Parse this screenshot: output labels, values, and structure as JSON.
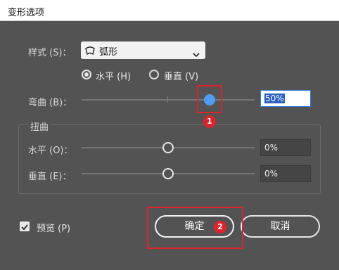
{
  "window": {
    "title": "变形选项"
  },
  "style_row": {
    "label": "样式 (S)：",
    "value": "弧形"
  },
  "orientation": {
    "horizontal_label": "水平 (H)",
    "vertical_label": "垂直 (V)",
    "selected": "horizontal"
  },
  "bend": {
    "label": "弯曲 (B)：",
    "value": "50%",
    "level_percent": 50
  },
  "distortion": {
    "group_label": "扭曲",
    "horizontal": {
      "label": "水平 (O)：",
      "value": "0%"
    },
    "vertical": {
      "label": "垂直 (E)：",
      "value": "0%"
    }
  },
  "preview": {
    "label": "预览 (P)",
    "checked": true
  },
  "buttons": {
    "ok": "确定",
    "cancel": "取消"
  },
  "annotations": {
    "badge1": "1",
    "badge2": "2",
    "color": "#e0232b"
  }
}
